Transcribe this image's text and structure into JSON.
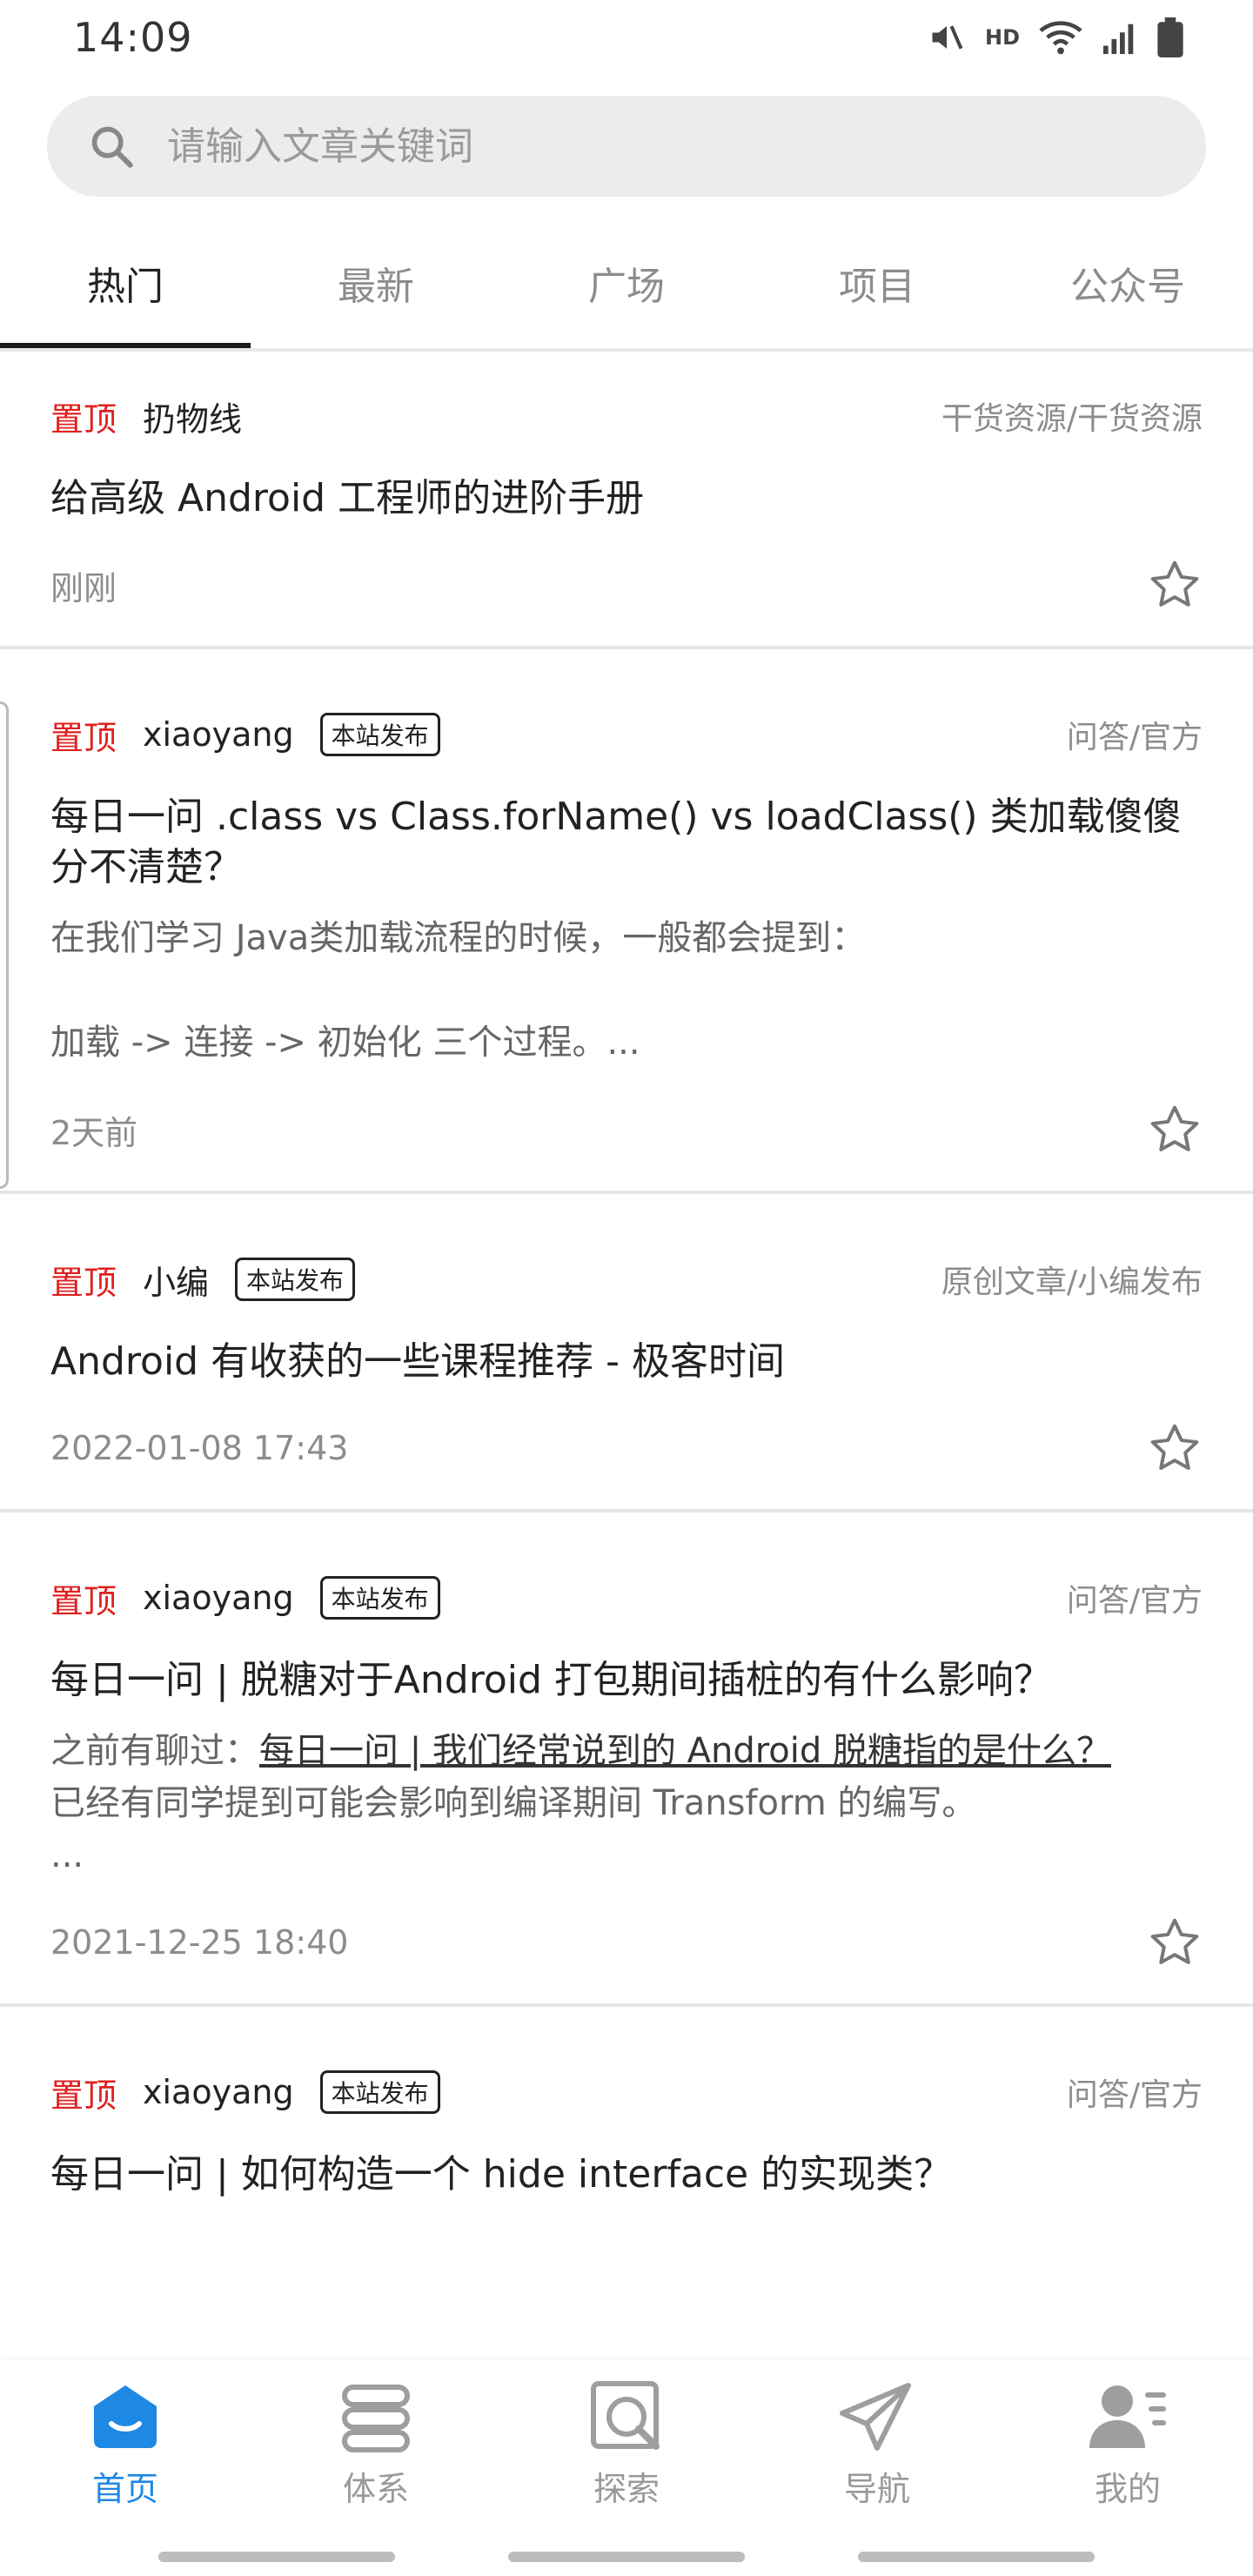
{
  "status_bar": {
    "time": "14:09",
    "hd_label": "HD",
    "icons": [
      "mute-icon",
      "wifi-icon",
      "signal-icon",
      "battery-icon"
    ]
  },
  "search": {
    "placeholder": "请输入文章关键词",
    "value": ""
  },
  "tabs": [
    {
      "label": "热门",
      "active": true
    },
    {
      "label": "最新",
      "active": false
    },
    {
      "label": "广场",
      "active": false
    },
    {
      "label": "项目",
      "active": false
    },
    {
      "label": "公众号",
      "active": false
    }
  ],
  "colors": {
    "pin_red": "#e02020",
    "accent_blue": "#1e88e5",
    "muted_gray": "#8c8c8c"
  },
  "articles": [
    {
      "pin": "置顶",
      "author": "扔物线",
      "badge": "",
      "category": "干货资源/干货资源",
      "title": "给高级 Android 工程师的进阶手册",
      "desc": "",
      "date": "刚刚"
    },
    {
      "pin": "置顶",
      "author": "xiaoyang",
      "badge": "本站发布",
      "category": "问答/官方",
      "title": "每日一问 .class vs Class.forName() vs loadClass() 类加载傻傻分不清楚？",
      "desc": "在我们学习 Java类加载流程的时候，一般都会提到：\n\n加载 -> 连接 -> 初始化 三个过程。...",
      "date": "2天前"
    },
    {
      "pin": "置顶",
      "author": "小编",
      "badge": "本站发布",
      "category": "原创文章/小编发布",
      "title": "Android 有收获的一些课程推荐 - 极客时间",
      "desc": "",
      "date": "2022-01-08 17:43"
    },
    {
      "pin": "置顶",
      "author": "xiaoyang",
      "badge": "本站发布",
      "category": "问答/官方",
      "title": "每日一问 | 脱糖对于Android 打包期间插桩的有什么影响？",
      "desc_prefix": "之前有聊过：",
      "desc_link": "每日一问 | 我们经常说到的 Android 脱糖指的是什么？",
      "desc_suffix": "已经有同学提到可能会影响到编译期间 Transform 的编写。\n...",
      "date": "2021-12-25 18:40"
    },
    {
      "pin": "置顶",
      "author": "xiaoyang",
      "badge": "本站发布",
      "category": "问答/官方",
      "title": "每日一问 | 如何构造一个 hide interface 的实现类？"
    }
  ],
  "bottom_nav": [
    {
      "label": "首页",
      "icon": "home-icon",
      "active": true
    },
    {
      "label": "体系",
      "icon": "layers-icon",
      "active": false
    },
    {
      "label": "探索",
      "icon": "explore-icon",
      "active": false
    },
    {
      "label": "导航",
      "icon": "paper-plane-icon",
      "active": false
    },
    {
      "label": "我的",
      "icon": "profile-icon",
      "active": false
    }
  ]
}
